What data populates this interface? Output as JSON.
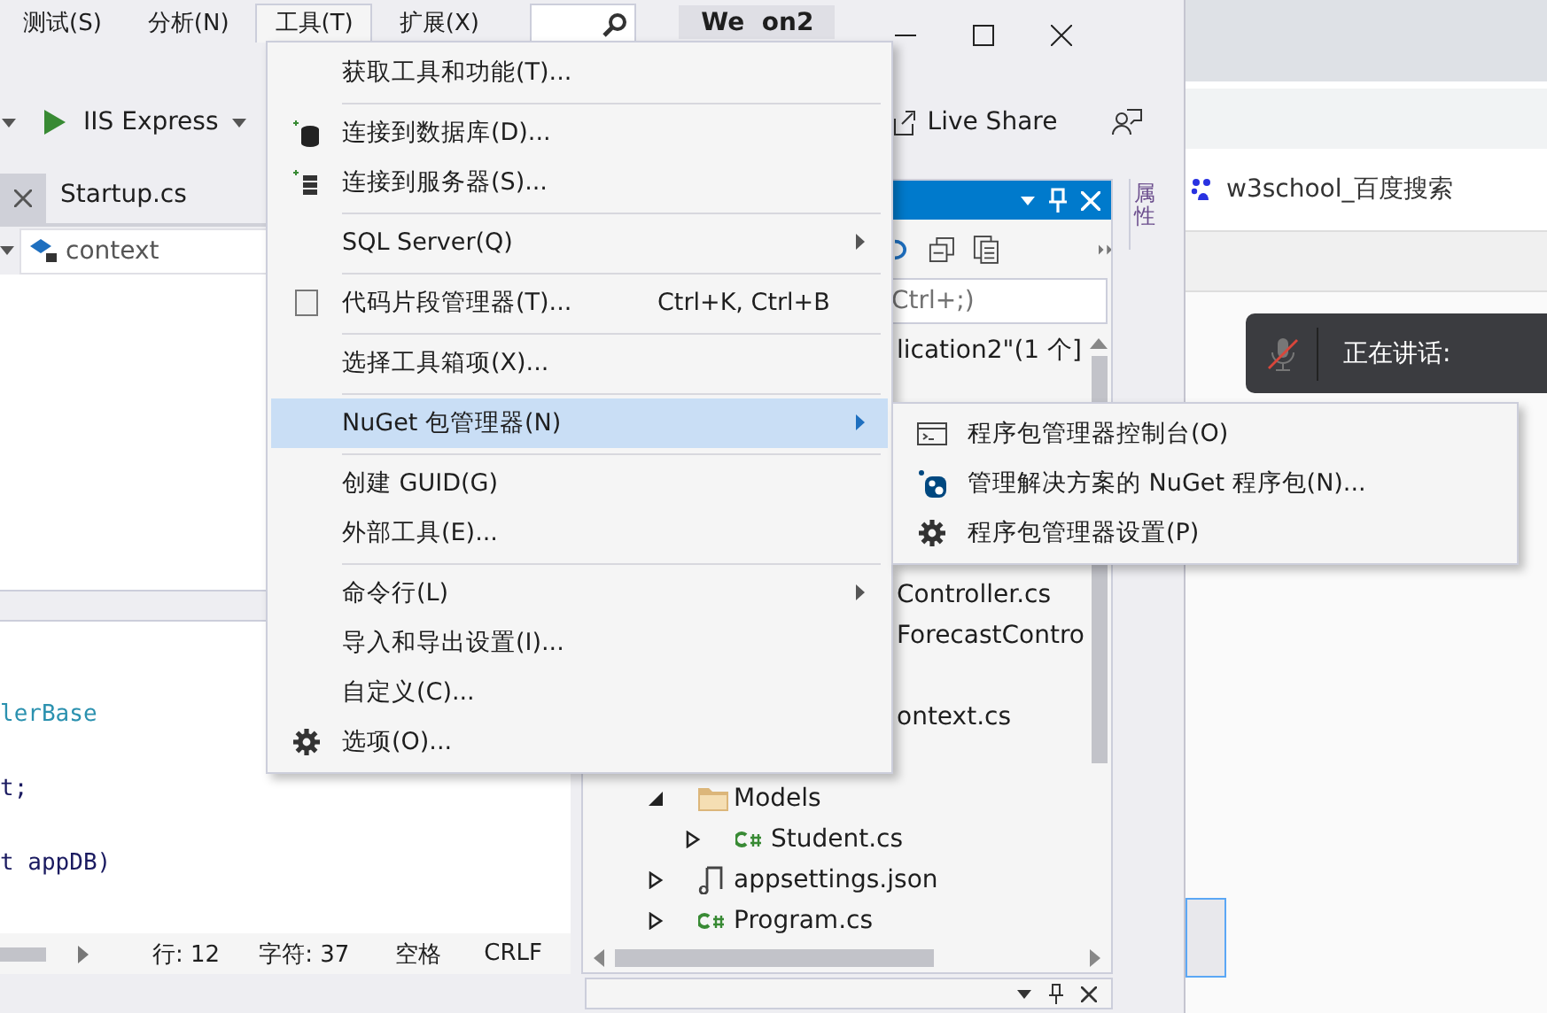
{
  "menubar": {
    "items": [
      {
        "label": "测试(S)",
        "selected": false
      },
      {
        "label": "分析(N)",
        "selected": false
      },
      {
        "label": "工具(T)",
        "selected": true
      },
      {
        "label": "扩展(X)",
        "selected": false
      }
    ]
  },
  "window": {
    "title": "We  on2"
  },
  "toolbar": {
    "run_target": "IIS Express",
    "live_share": "Live Share"
  },
  "editor": {
    "tabs": [
      {
        "label": "Startup.cs",
        "selected": true
      }
    ],
    "nav_member": "context",
    "code_lines": [
      {
        "text": "lerBase",
        "kind": "type"
      },
      {
        "text": "t;",
        "kind": "plain"
      },
      {
        "text": "t appDB)",
        "kind": "plain"
      }
    ]
  },
  "status_bar": {
    "line": "行: 12",
    "column": "字符: 37",
    "indent": "空格",
    "line_ending": "CRLF"
  },
  "solution_explorer": {
    "search_placeholder": "Ctrl+;)",
    "tree": [
      {
        "kind": "clipped",
        "label": "lication2\"(1 个]"
      },
      {
        "kind": "clipped",
        "label": "Controller.cs"
      },
      {
        "kind": "clipped",
        "label": "ForecastContro"
      },
      {
        "kind": "clipped",
        "label": "ontext.cs"
      },
      {
        "kind": "folder",
        "label": "Models",
        "expanded": true,
        "children": [
          {
            "kind": "csharp",
            "label": "Student.cs",
            "expanded": false
          }
        ]
      },
      {
        "kind": "json",
        "label": "appsettings.json",
        "expanded": false
      },
      {
        "kind": "csharp",
        "label": "Program.cs",
        "expanded": false
      }
    ]
  },
  "side_tab": "属性",
  "tools_menu": {
    "items": [
      {
        "kind": "item",
        "label": "获取工具和功能(T)..."
      },
      {
        "kind": "separator"
      },
      {
        "kind": "item",
        "label": "连接到数据库(D)..."
      },
      {
        "kind": "item",
        "label": "连接到服务器(S)..."
      },
      {
        "kind": "separator"
      },
      {
        "kind": "submenu",
        "label": "SQL Server(Q)",
        "selected": false
      },
      {
        "kind": "separator"
      },
      {
        "kind": "item",
        "label": "代码片段管理器(T)...",
        "shortcut": "Ctrl+K, Ctrl+B"
      },
      {
        "kind": "separator"
      },
      {
        "kind": "item",
        "label": "选择工具箱项(X)..."
      },
      {
        "kind": "separator"
      },
      {
        "kind": "submenu",
        "label": "NuGet 包管理器(N)",
        "selected": true
      },
      {
        "kind": "separator"
      },
      {
        "kind": "item",
        "label": "创建 GUID(G)"
      },
      {
        "kind": "item",
        "label": "外部工具(E)..."
      },
      {
        "kind": "separator"
      },
      {
        "kind": "submenu",
        "label": "命令行(L)",
        "selected": false
      },
      {
        "kind": "item",
        "label": "导入和导出设置(I)..."
      },
      {
        "kind": "item",
        "label": "自定义(C)..."
      },
      {
        "kind": "item",
        "label": "选项(O)..."
      }
    ]
  },
  "nuget_submenu": {
    "items": [
      {
        "label": "程序包管理器控制台(O)"
      },
      {
        "label": "管理解决方案的 NuGet 程序包(N)..."
      },
      {
        "label": "程序包管理器设置(P)"
      }
    ]
  },
  "browser": {
    "tab_title": "w3school_百度搜索",
    "speaking_toast": "正在讲话:"
  }
}
